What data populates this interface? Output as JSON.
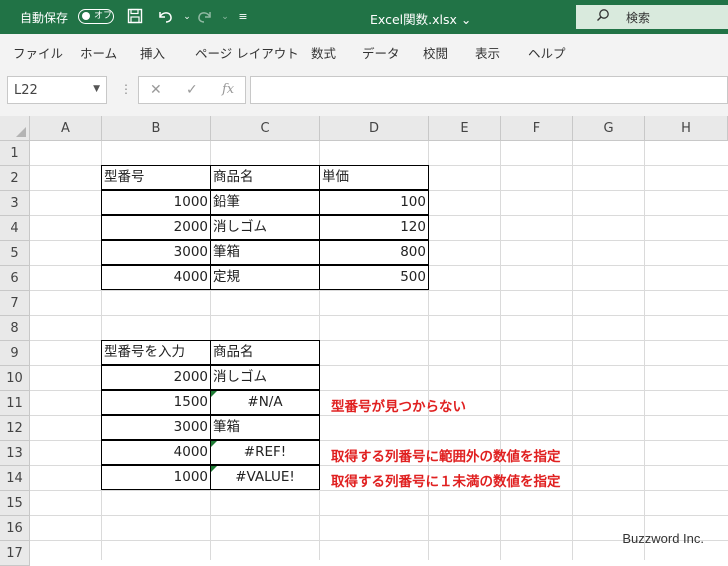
{
  "titlebar": {
    "autosave_label": "自動保存",
    "autosave_state": "オフ",
    "filename": "Excel関数.xlsx ⌄",
    "search_placeholder": "検索"
  },
  "menu": [
    "ファイル",
    "ホーム",
    "挿入",
    "ページ レイアウト",
    "数式",
    "データ",
    "校閲",
    "表示",
    "ヘルプ"
  ],
  "formula_bar": {
    "name_box": "L22",
    "fx": "fx",
    "formula": ""
  },
  "columns": [
    "A",
    "B",
    "C",
    "D",
    "E",
    "F",
    "G",
    "H"
  ],
  "rows": [
    "1",
    "2",
    "3",
    "4",
    "5",
    "6",
    "7",
    "8",
    "9",
    "10",
    "11",
    "12",
    "13",
    "14",
    "15",
    "16",
    "17"
  ],
  "table1": {
    "headers": [
      "型番号",
      "商品名",
      "単価"
    ],
    "rows": [
      [
        "1000",
        "鉛筆",
        "100"
      ],
      [
        "2000",
        "消しゴム",
        "120"
      ],
      [
        "3000",
        "筆箱",
        "800"
      ],
      [
        "4000",
        "定規",
        "500"
      ]
    ]
  },
  "table2": {
    "headers": [
      "型番号を入力",
      "商品名"
    ],
    "rows": [
      [
        "2000",
        "消しゴム"
      ],
      [
        "1500",
        "#N/A"
      ],
      [
        "3000",
        "筆箱"
      ],
      [
        "4000",
        "#REF!"
      ],
      [
        "1000",
        "#VALUE!"
      ]
    ]
  },
  "notes": {
    "r11": "型番号が見つからない",
    "r13": "取得する列番号に範囲外の数値を指定",
    "r14": "取得する列番号に１未満の数値を指定"
  },
  "watermark": "Buzzword Inc.",
  "colors": {
    "accent": "#217346",
    "note": "#e02020"
  }
}
